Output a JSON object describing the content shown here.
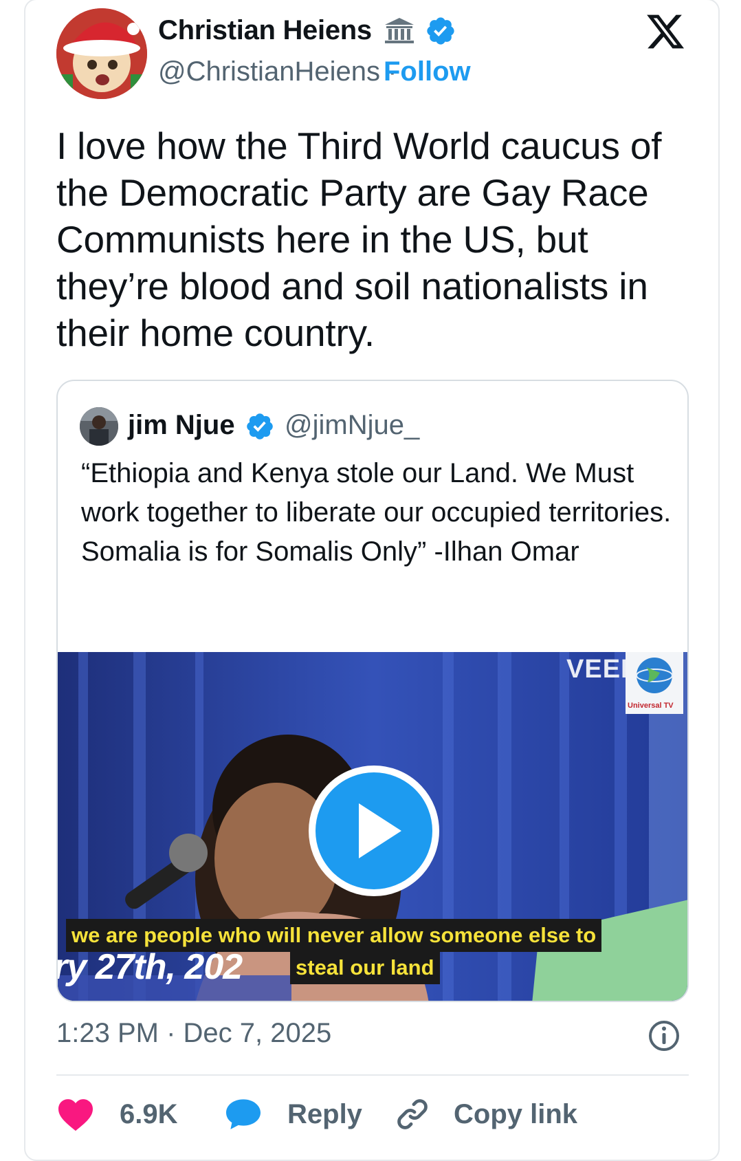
{
  "author": {
    "name": "Christian Heiens",
    "handle": "@ChristianHeiens",
    "separator": "·",
    "follow_label": "Follow"
  },
  "tweet": {
    "text": "I love how the Third World caucus of the Democratic Party are Gay Race Communists here in the US, but they’re blood and soil nationalists in their home country.",
    "timestamp": "1:23 PM · Dec 7, 2025"
  },
  "quoted_tweet": {
    "name": "jim Njue",
    "handle": "@jimNjue_",
    "text": "“Ethiopia and Kenya stole our Land. We Must work together to liberate our occupied territories. Somalia is for Somalis Only” -Ilhan Omar",
    "video": {
      "watermark": "VEED.IO",
      "channel_label": "Universal TV",
      "caption_line1": "we are people who will never allow someone else to",
      "caption_line2": "steal our land",
      "ticker_text": "ry 27th, 202"
    }
  },
  "actions": {
    "likes": "6.9K",
    "reply_label": "Reply",
    "copy_label": "Copy link"
  },
  "colors": {
    "accent": "#1d9bf0",
    "like": "#f91880",
    "caption_text": "#f6e23a",
    "muted": "#536471"
  },
  "icons": {
    "gov": "government-building-icon",
    "verified": "verified-badge-icon",
    "brand": "x-logo-icon",
    "play": "play-icon",
    "info": "info-icon",
    "like": "heart-icon",
    "reply": "speech-bubble-icon",
    "copy": "link-icon"
  }
}
